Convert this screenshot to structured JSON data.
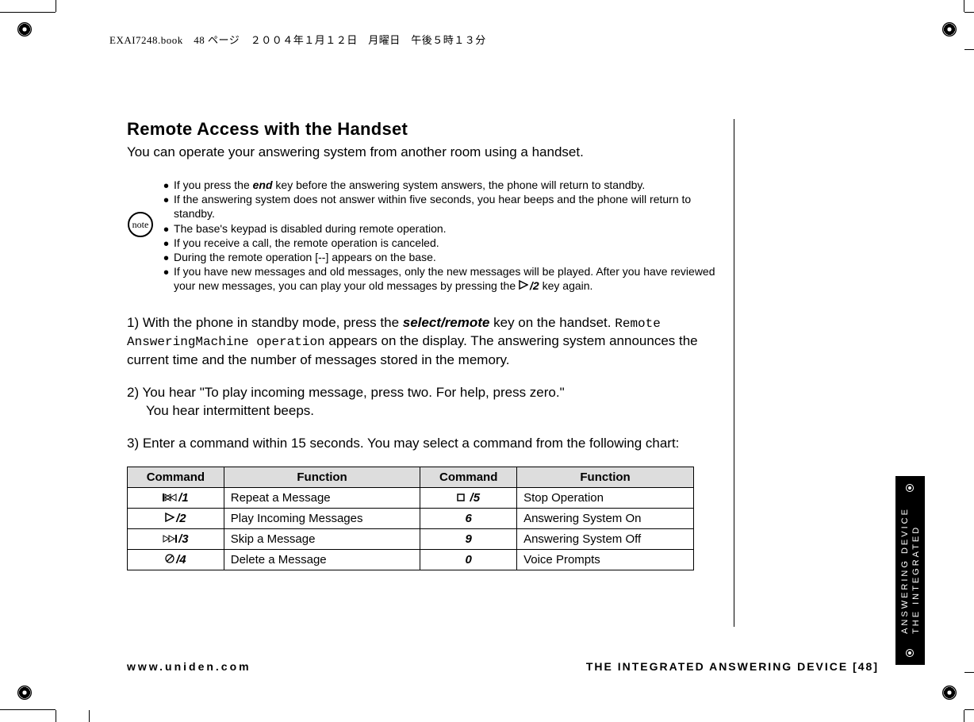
{
  "header_line": "EXAI7248.book　48 ページ　２００４年１月１２日　月曜日　午後５時１３分",
  "title": "Remote Access with the Handset",
  "intro": "You can operate your answering system from another room using a handset.",
  "note_label": "note",
  "notes": [
    {
      "pre": "If you press the ",
      "key": "end",
      "post": " key before the answering system answers, the phone will return to standby."
    },
    {
      "text": "If the answering system does not answer within five seconds, you hear beeps and the phone will return to standby."
    },
    {
      "text": "The base's keypad is disabled during remote operation."
    },
    {
      "text": "If you receive a call, the remote operation is canceled."
    },
    {
      "text": "During the remote operation [--] appears on the base."
    },
    {
      "pre": "If you have new messages and old messages, only the new messages will be played. After you have reviewed your new messages, you can play your old messages by pressing the ",
      "icon": "play",
      "key": "/2",
      "post": " key again."
    }
  ],
  "step1": {
    "a": "1) With the phone in standby mode, press the ",
    "b": "select/remote",
    "c": " key on the handset. ",
    "d": "Remote AnsweringMachine operation",
    "e": " appears on the display. The answering system announces the current time and the number of messages stored in the memory."
  },
  "step2a": "2) You hear \"To play incoming message, press two. For help, press zero.\"",
  "step2b": "You hear intermittent beeps.",
  "step3": "3) Enter a command within 15 seconds. You may select a command from the following chart:",
  "table": {
    "headers": [
      "Command",
      "Function",
      "Command",
      "Function"
    ],
    "rows": [
      {
        "c1": {
          "sym": "rewind",
          "key": "/1"
        },
        "f1": "Repeat a Message",
        "c2": {
          "sym": "stop",
          "key": "/5"
        },
        "f2": "Stop Operation"
      },
      {
        "c1": {
          "sym": "play",
          "key": "/2"
        },
        "f1": "Play Incoming Messages",
        "c2": {
          "sym": "",
          "key": "6"
        },
        "f2": "Answering System On"
      },
      {
        "c1": {
          "sym": "fwd",
          "key": "/3"
        },
        "f1": "Skip a Message",
        "c2": {
          "sym": "",
          "key": "9"
        },
        "f2": "Answering System Off"
      },
      {
        "c1": {
          "sym": "del",
          "key": "/4"
        },
        "f1": "Delete a Message",
        "c2": {
          "sym": "",
          "key": "0"
        },
        "f2": "Voice Prompts"
      }
    ]
  },
  "side_tab_l1": "THE INTEGRATED",
  "side_tab_l2": "ANSWERING DEVICE",
  "footer_left": "www.uniden.com",
  "footer_right": "THE INTEGRATED ANSWERING DEVICE [48]"
}
